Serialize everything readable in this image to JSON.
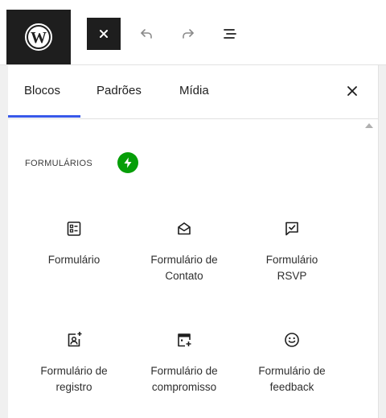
{
  "toolbar": {
    "logo_icon": "wordpress-logo-icon",
    "close_icon": "close-icon",
    "undo_icon": "undo-icon",
    "redo_icon": "redo-icon",
    "document_overview_icon": "list-view-icon"
  },
  "inserter": {
    "tabs": [
      {
        "label": "Blocos",
        "selected": true
      },
      {
        "label": "Padrões",
        "selected": false
      },
      {
        "label": "Mídia",
        "selected": false
      }
    ],
    "close_icon": "close-icon",
    "category": {
      "title": "FORMULÁRIOS",
      "badge_icon": "jetpack-icon",
      "badge_color": "#069e08"
    },
    "blocks": [
      {
        "label": "Formulário",
        "icon": "form-icon"
      },
      {
        "label": "Formulário de Contato",
        "icon": "contact-form-icon"
      },
      {
        "label": "Formulário RSVP",
        "icon": "rsvp-icon"
      },
      {
        "label": "Formulário de registro",
        "icon": "registration-icon"
      },
      {
        "label": "Formulário de compromisso",
        "icon": "appointment-icon"
      },
      {
        "label": "Formulário de feedback",
        "icon": "feedback-icon"
      }
    ]
  },
  "colors": {
    "accent": "#3858e9",
    "dark": "#1e1e1e"
  }
}
